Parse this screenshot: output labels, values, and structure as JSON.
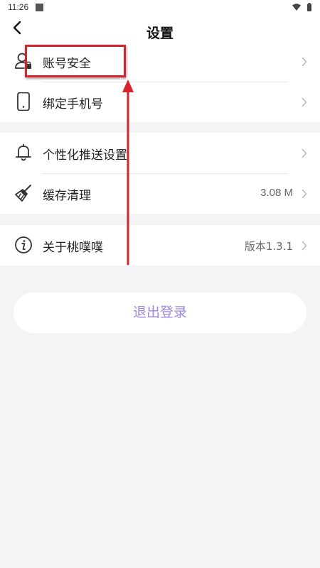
{
  "status_bar": {
    "time": "11:26"
  },
  "header": {
    "title": "设置",
    "back_icon": "chevron-left-icon"
  },
  "groups": [
    {
      "items": [
        {
          "label": "账号安全",
          "value": "",
          "icon": "user-lock-icon"
        },
        {
          "label": "绑定手机号",
          "value": "",
          "icon": "phone-icon"
        }
      ]
    },
    {
      "items": [
        {
          "label": "个性化推送设置",
          "value": "",
          "icon": "bell-icon"
        },
        {
          "label": "缓存清理",
          "value": "3.08 M",
          "icon": "broom-icon"
        }
      ]
    },
    {
      "items": [
        {
          "label": "关于桃噗噗",
          "value": "版本1.3.1",
          "icon": "info-icon"
        }
      ]
    }
  ],
  "logout": {
    "label": "退出登录"
  },
  "colors": {
    "background": "#f3f4f6",
    "accent": "#9b87f0",
    "annotation": "#d9232a"
  }
}
